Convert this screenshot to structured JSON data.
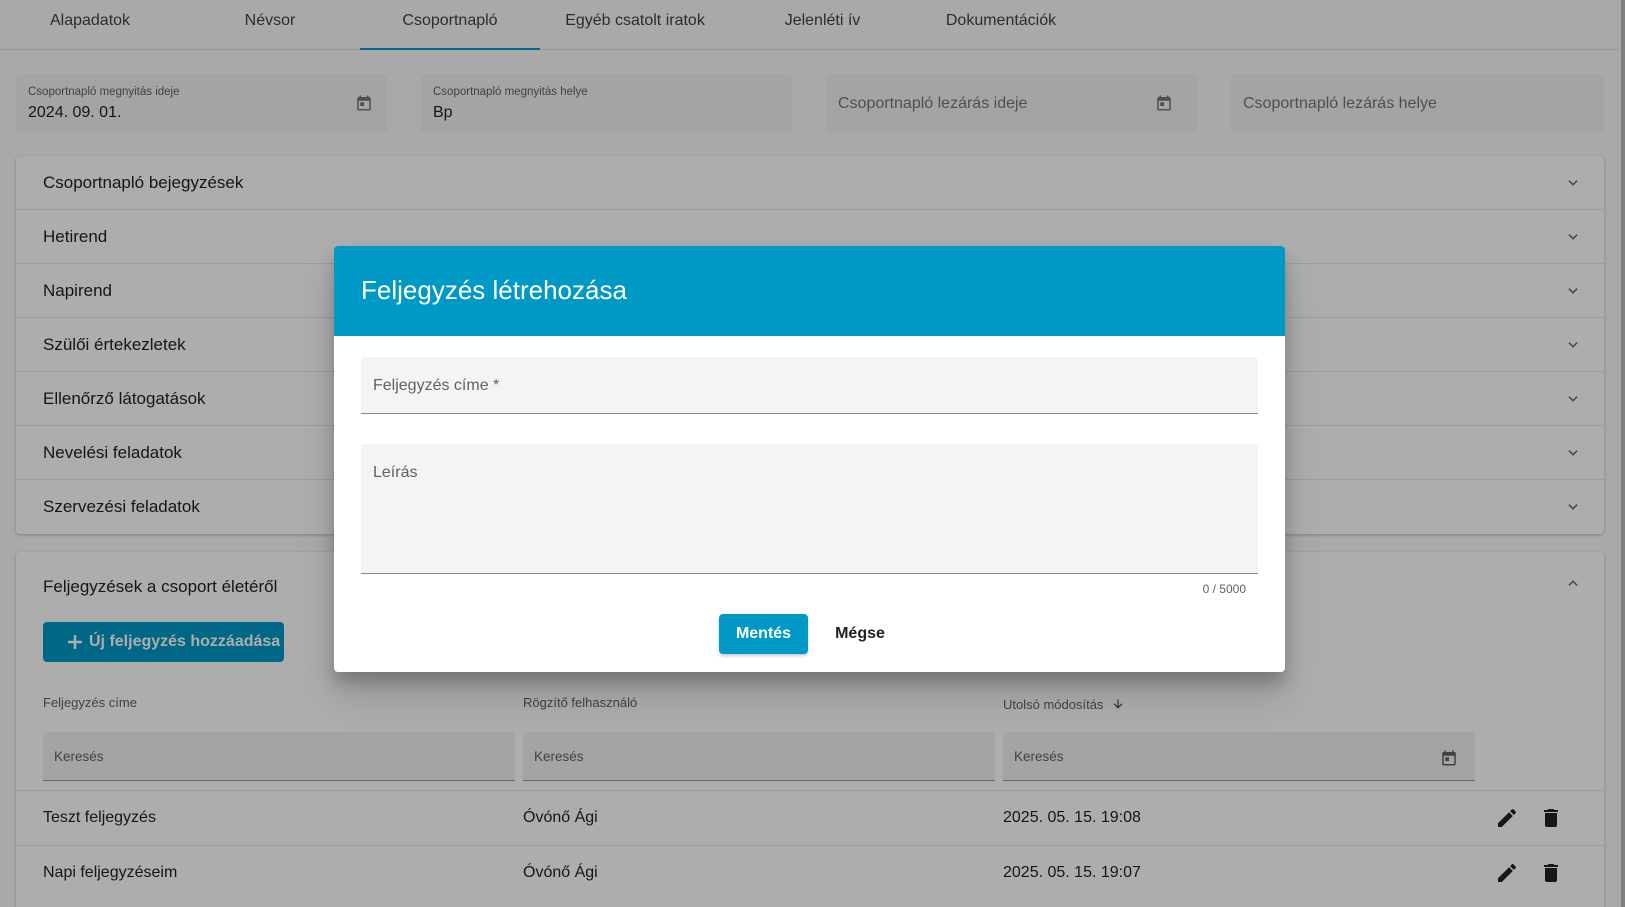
{
  "tabs": [
    {
      "label": "Alapadatok"
    },
    {
      "label": "Névsor"
    },
    {
      "label": "Csoportnapló"
    },
    {
      "label": "Egyéb csatolt iratok"
    },
    {
      "label": "Jelenléti ív"
    },
    {
      "label": "Dokumentációk"
    }
  ],
  "fields": {
    "open_date": {
      "label": "Csoportnapló megnyitás ideje",
      "value": "2024. 09. 01."
    },
    "open_place": {
      "label": "Csoportnapló megnyitás helye",
      "value": "Bp"
    },
    "close_date": {
      "placeholder": "Csoportnapló lezárás ideje"
    },
    "close_place": {
      "placeholder": "Csoportnapló lezárás helye"
    }
  },
  "accordion": [
    {
      "label": "Csoportnapló bejegyzések"
    },
    {
      "label": "Hetirend"
    },
    {
      "label": "Napirend"
    },
    {
      "label": "Szülői értekezletek"
    },
    {
      "label": "Ellenőrző látogatások"
    },
    {
      "label": "Nevelési feladatok"
    },
    {
      "label": "Szervezési feladatok"
    }
  ],
  "notes": {
    "title": "Feljegyzések a csoport életéről",
    "add_label": "Új feljegyzés hozzáadása",
    "columns": [
      "Feljegyzés címe",
      "Rögzítő felhasználó",
      "Utolsó módosítás"
    ],
    "search_placeholder": "Keresés",
    "rows": [
      {
        "title": "Teszt feljegyzés",
        "user": "Óvónő Ági",
        "modified": "2025. 05. 15. 19:08"
      },
      {
        "title": "Napi feljegyzéseim",
        "user": "Óvónő Ági",
        "modified": "2025. 05. 15. 19:07"
      }
    ]
  },
  "dialog": {
    "title": "Feljegyzés létrehozása",
    "title_placeholder": "Feljegyzés címe *",
    "desc_placeholder": "Leírás",
    "counter": "0 / 5000",
    "save_label": "Mentés",
    "cancel_label": "Mégse"
  },
  "colors": {
    "accent": "#0099c6"
  }
}
